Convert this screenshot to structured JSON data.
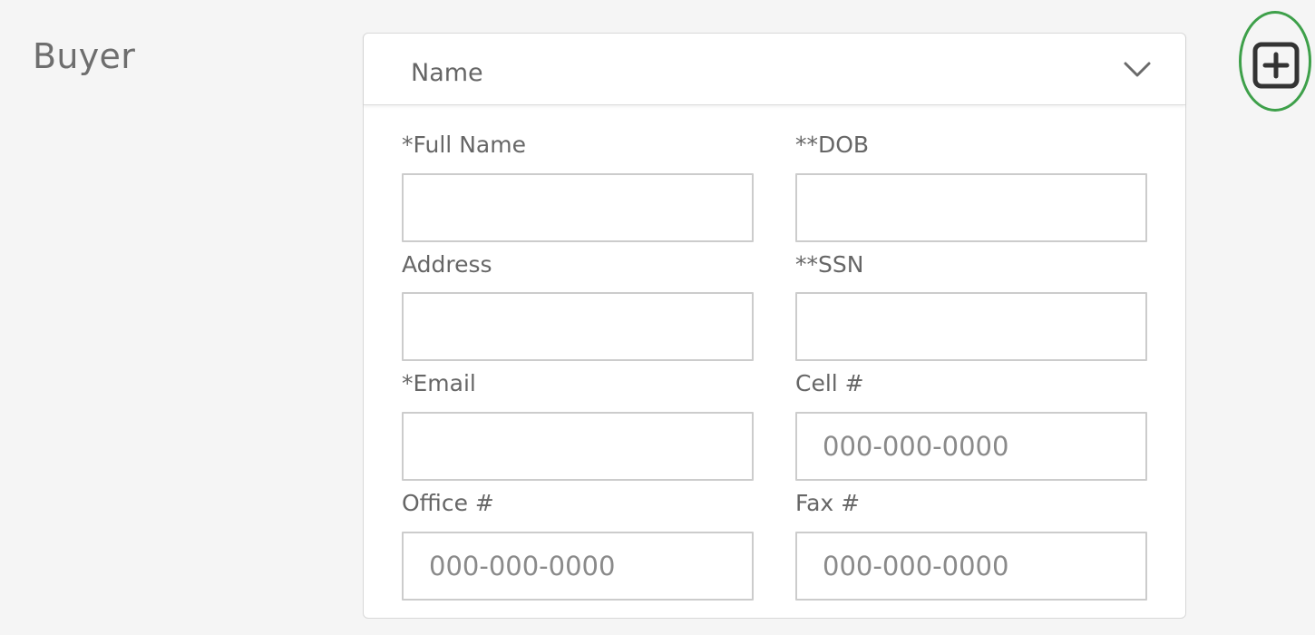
{
  "section": {
    "label": "Buyer"
  },
  "card": {
    "header_title": "Name",
    "header_icon": "chevron-down-icon"
  },
  "fields": {
    "full_name": {
      "label": "*Full Name",
      "value": "",
      "placeholder": ""
    },
    "dob": {
      "label": "**DOB",
      "value": "",
      "placeholder": ""
    },
    "address": {
      "label": "Address",
      "value": "",
      "placeholder": ""
    },
    "ssn": {
      "label": "**SSN",
      "value": "",
      "placeholder": ""
    },
    "email": {
      "label": "*Email",
      "value": "",
      "placeholder": ""
    },
    "cell": {
      "label": "Cell #",
      "value": "",
      "placeholder": "000-000-0000"
    },
    "office": {
      "label": "Office #",
      "value": "",
      "placeholder": "000-000-0000"
    },
    "fax": {
      "label": "Fax #",
      "value": "",
      "placeholder": "000-000-0000"
    }
  },
  "add_button": {
    "icon": "plus-square-icon",
    "highlight_color": "#3ea04a"
  },
  "colors": {
    "background": "#f5f5f5",
    "card": "#ffffff",
    "border": "#cccccc",
    "text": "#666666"
  }
}
